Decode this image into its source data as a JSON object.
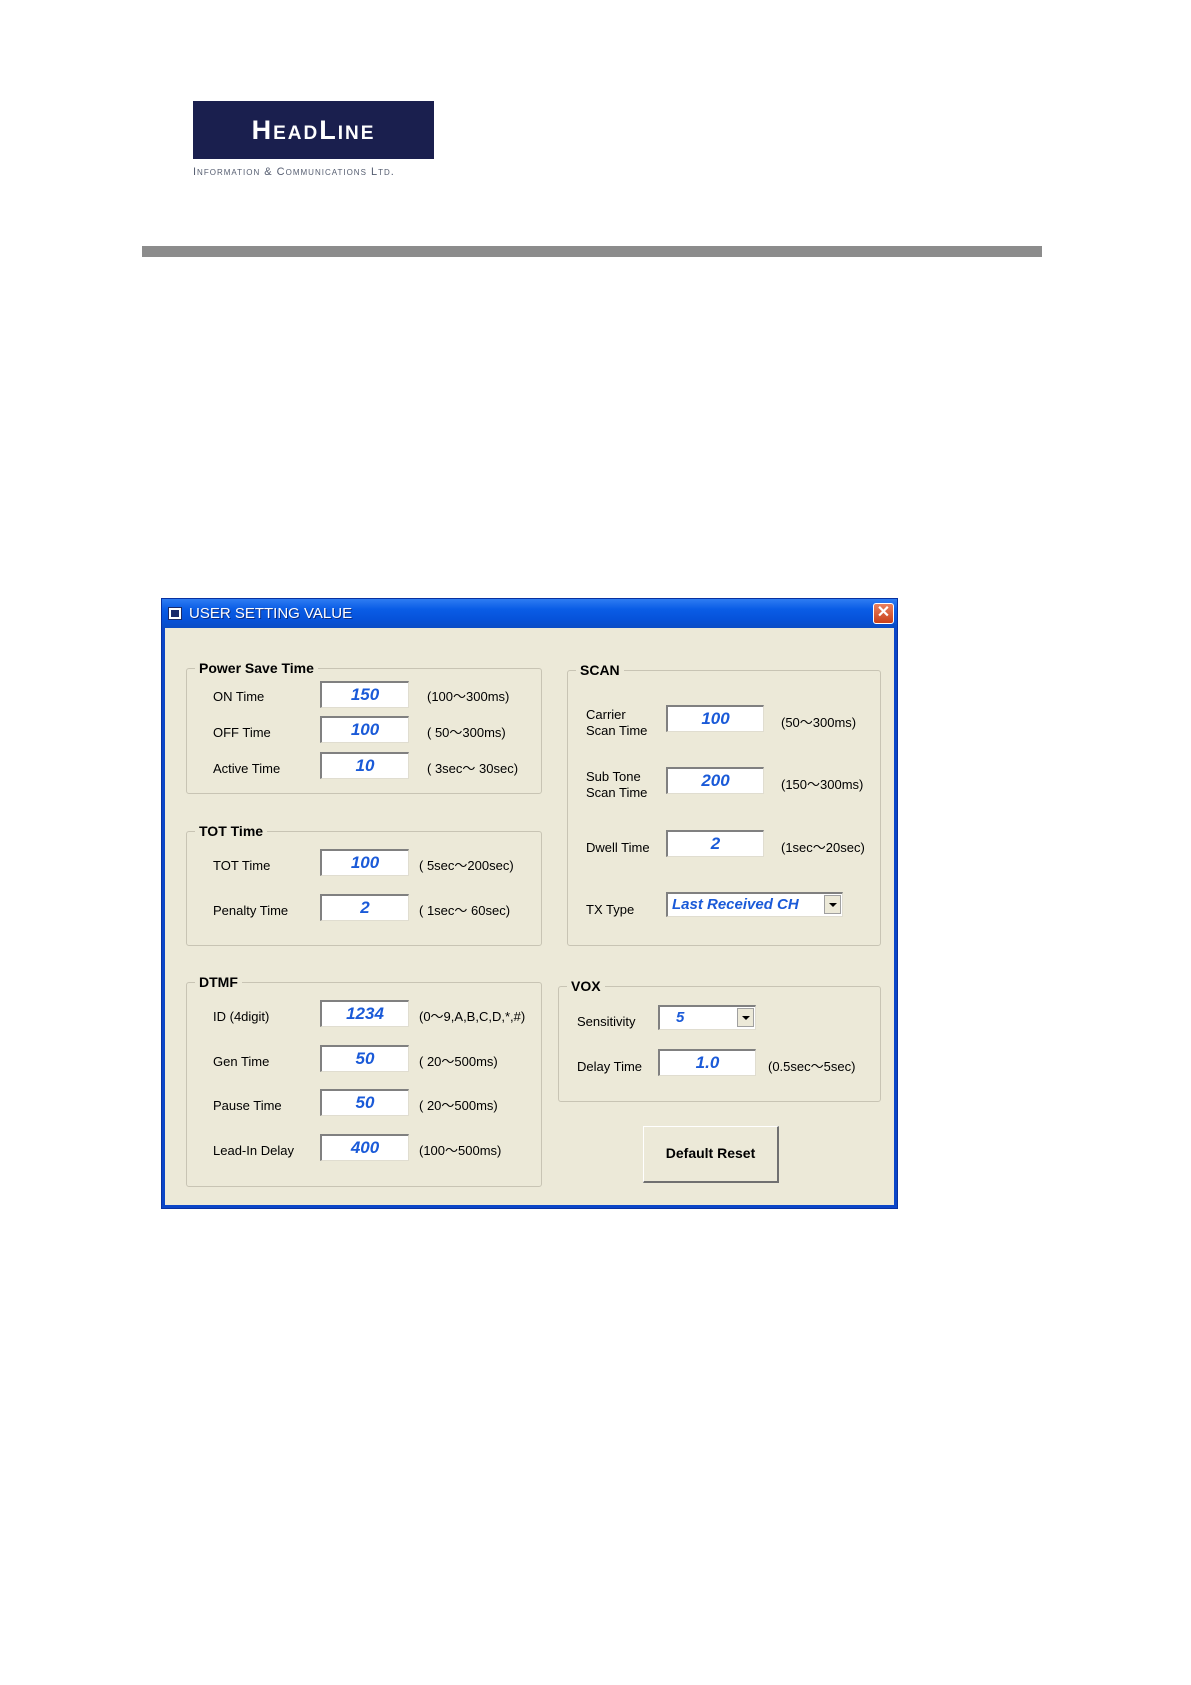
{
  "logo": {
    "word": "HeadLine",
    "subtitle": "Information & Communications Ltd."
  },
  "window": {
    "title": "USER SETTING VALUE",
    "close_label": "✕"
  },
  "power_save": {
    "title": "Power Save Time",
    "on": {
      "label": "ON Time",
      "value": "150",
      "range": "(100～300ms)"
    },
    "off": {
      "label": "OFF Time",
      "value": "100",
      "range": "( 50～300ms)"
    },
    "active": {
      "label": "Active Time",
      "value": "10",
      "range": "( 3sec～ 30sec)"
    }
  },
  "tot": {
    "title": "TOT Time",
    "tot": {
      "label": "TOT Time",
      "value": "100",
      "range": "( 5sec～200sec)"
    },
    "penalty": {
      "label": "Penalty Time",
      "value": "2",
      "range": "( 1sec～ 60sec)"
    }
  },
  "dtmf": {
    "title": "DTMF",
    "id": {
      "label": "ID (4digit)",
      "value": "1234",
      "range": "(0～9,A,B,C,D,*,#)"
    },
    "gen": {
      "label": "Gen Time",
      "value": "50",
      "range": "( 20～500ms)"
    },
    "pause": {
      "label": "Pause Time",
      "value": "50",
      "range": "( 20～500ms)"
    },
    "leadin": {
      "label": "Lead-In Delay",
      "value": "400",
      "range": "(100～500ms)"
    }
  },
  "scan": {
    "title": "SCAN",
    "carrier": {
      "label1": "Carrier",
      "label2": "Scan Time",
      "value": "100",
      "range": "(50～300ms)"
    },
    "subtone": {
      "label1": "Sub Tone",
      "label2": "Scan Time",
      "value": "200",
      "range": "(150～300ms)"
    },
    "dwell": {
      "label": "Dwell Time",
      "value": "2",
      "range": "(1sec～20sec)"
    },
    "tx": {
      "label": "TX Type",
      "value": "Last Received CH"
    }
  },
  "vox": {
    "title": "VOX",
    "sensitivity": {
      "label": "Sensitivity",
      "value": "5"
    },
    "delay": {
      "label": "Delay Time",
      "value": "1.0",
      "range": "(0.5sec～5sec)"
    }
  },
  "buttons": {
    "default_reset": "Default Reset"
  },
  "colors": {
    "titlebar": "#0a5de6",
    "field_text": "#1a5ad8",
    "dialog_bg": "#ece9d8"
  }
}
